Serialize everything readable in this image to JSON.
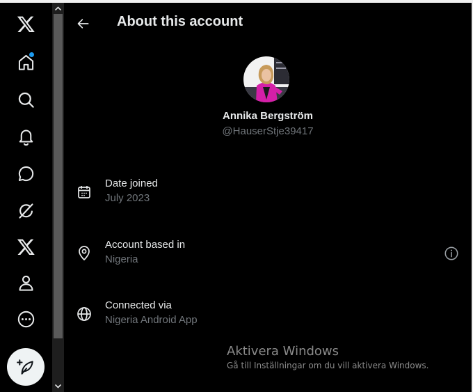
{
  "header": {
    "title": "About this account"
  },
  "profile": {
    "display_name": "Annika Bergström",
    "handle": "@HauserStje39417"
  },
  "details": [
    {
      "label": "Date joined",
      "value": "July 2023"
    },
    {
      "label": "Account based in",
      "value": "Nigeria"
    },
    {
      "label": "Connected via",
      "value": "Nigeria Android App"
    }
  ],
  "watermark": {
    "title": "Aktivera Windows",
    "subtitle": "Gå till Inställningar om du vill aktivera Windows."
  },
  "nav": [
    "x-logo-icon",
    "home-icon",
    "search-icon",
    "bell-icon",
    "message-icon",
    "grok-icon",
    "x-premium-icon",
    "profile-icon",
    "more-icon",
    "compose-icon"
  ],
  "colors": {
    "background": "#000000",
    "text": "#e7e9ea",
    "muted": "#71767b",
    "accent": "#1d9bf0"
  }
}
